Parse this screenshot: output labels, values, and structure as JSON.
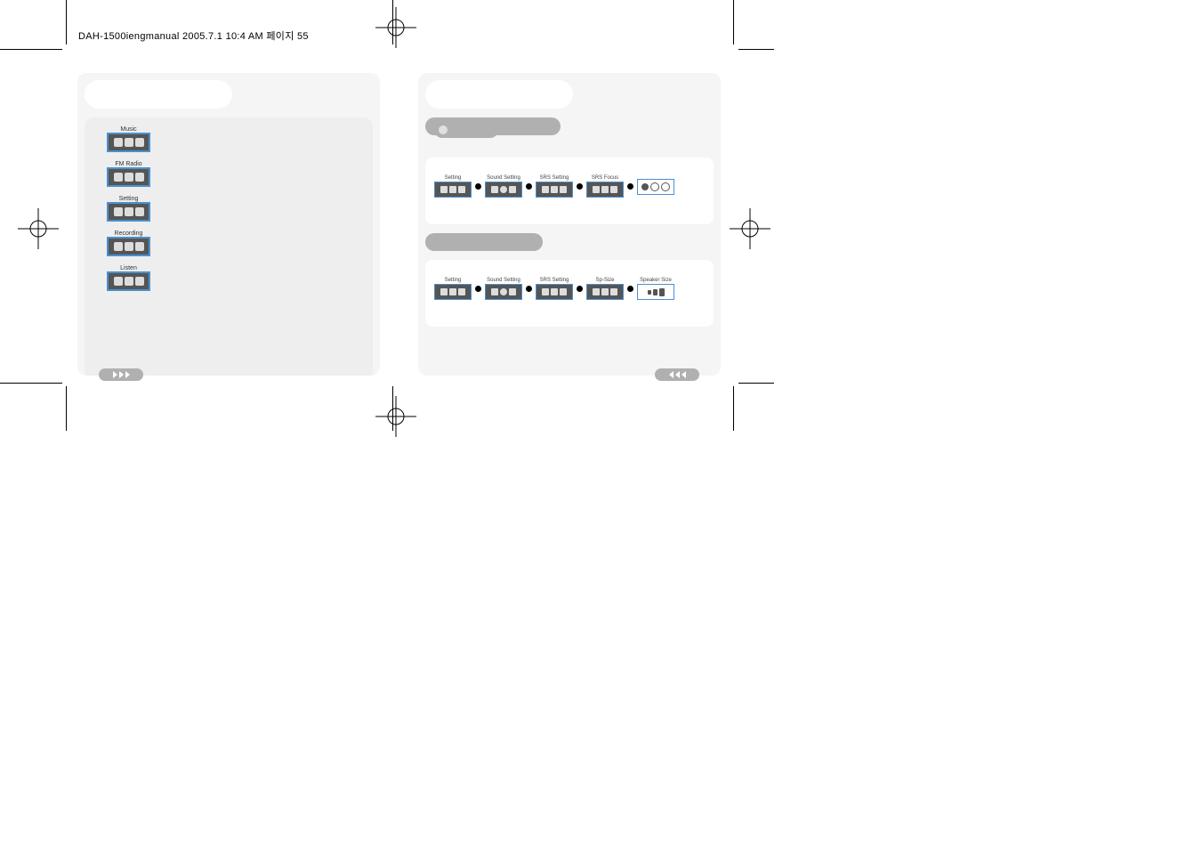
{
  "header": "DAH-1500iengmanual  2005.7.1 10:4 AM 페이지 55",
  "menu": {
    "items": [
      {
        "label": "Music"
      },
      {
        "label": "FM Radio"
      },
      {
        "label": "Setting"
      },
      {
        "label": "Recording"
      },
      {
        "label": "Listen"
      }
    ]
  },
  "flow_srs_focus": {
    "steps": [
      {
        "label": "Setting"
      },
      {
        "label": "Sound Setting"
      },
      {
        "label": "SRS Setting"
      },
      {
        "label": "SRS Focus"
      },
      {
        "label": ""
      }
    ]
  },
  "flow_sp_size": {
    "steps": [
      {
        "label": "Setting"
      },
      {
        "label": "Sound Setting"
      },
      {
        "label": "SRS Setting"
      },
      {
        "label": "Sp-Size"
      },
      {
        "label": "Speaker Size"
      }
    ]
  }
}
